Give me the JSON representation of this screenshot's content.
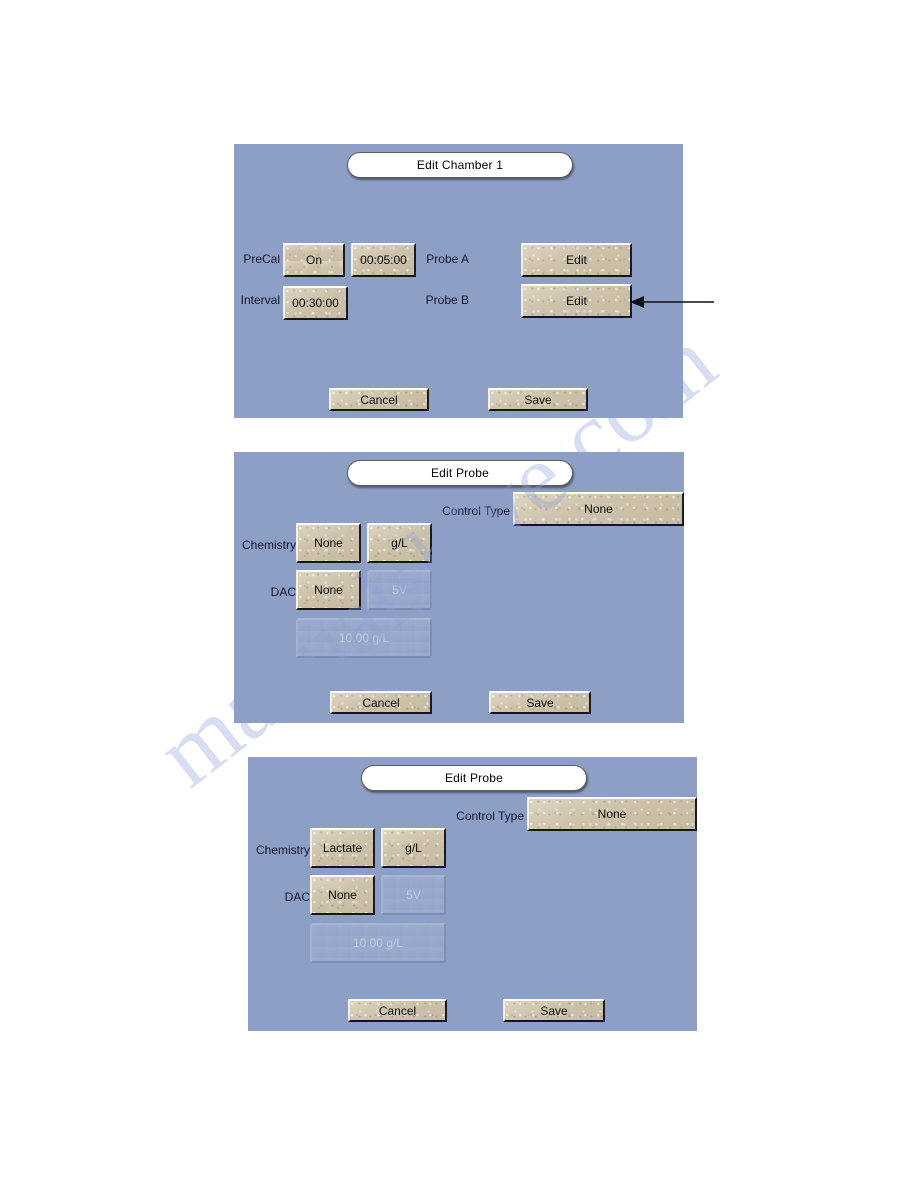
{
  "screens": [
    {
      "id": "edit-chamber-1",
      "title": "Edit Chamber 1",
      "fields": {
        "precal_label": "PreCal",
        "precal_state": "On",
        "precal_time": "00:05:00",
        "interval_label": "Interval",
        "interval_time": "00:30:00",
        "probe_a_label": "Probe A",
        "probe_a_button": "Edit",
        "probe_b_label": "Probe B",
        "probe_b_button": "Edit"
      },
      "cancel_label": "Cancel",
      "save_label": "Save",
      "annotation": {
        "name": "callout-arrow-probe-b",
        "points_to": "Probe B Edit"
      }
    },
    {
      "id": "edit-probe-none",
      "title": "Edit Probe",
      "fields": {
        "control_type_label": "Control Type",
        "control_type_value": "None",
        "chemistry_label": "Chemistry",
        "chemistry_value": "None",
        "chemistry_units": "g/L",
        "dac_label": "DAC",
        "dac_value": "None",
        "dac_voltage": "5V",
        "dac_fullscale": "10.00 g/L"
      },
      "cancel_label": "Cancel",
      "save_label": "Save"
    },
    {
      "id": "edit-probe-lactate",
      "title": "Edit Probe",
      "fields": {
        "control_type_label": "Control Type",
        "control_type_value": "None",
        "chemistry_label": "Chemistry",
        "chemistry_value": "Lactate",
        "chemistry_units": "g/L",
        "dac_label": "DAC",
        "dac_value": "None",
        "dac_voltage": "5V",
        "dac_fullscale": "10.00 g/L"
      },
      "cancel_label": "Cancel",
      "save_label": "Save"
    }
  ],
  "colors": {
    "screen_background": "#8e9fc6",
    "button_face": "#cfc5ae",
    "toggle_on": "#8ff0a4",
    "disabled_text": "#c3ccdf",
    "title_pill": "#ffffff"
  },
  "watermark": {
    "text": "manualshive.com"
  }
}
